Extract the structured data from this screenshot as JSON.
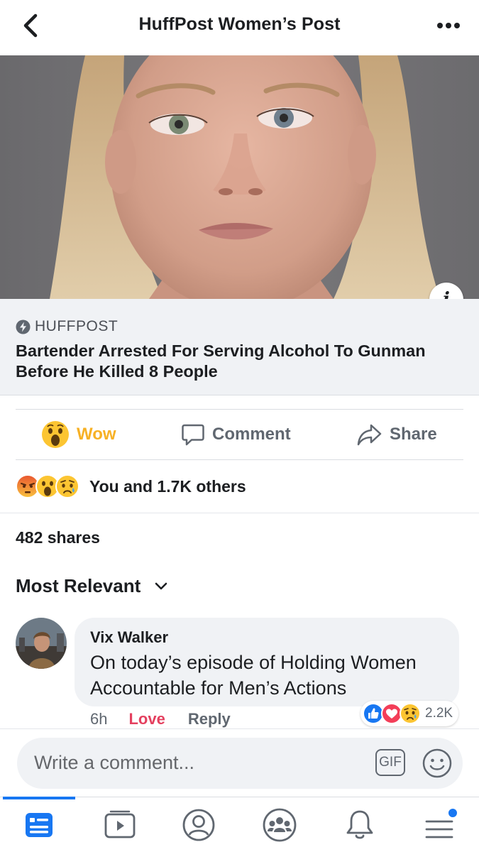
{
  "header": {
    "title": "HuffPost Women’s Post"
  },
  "link_card": {
    "source": "HUFFPOST",
    "headline": "Bartender Arrested For Serving Alcohol To Gunman Before He Killed 8 People",
    "info_glyph": "i"
  },
  "actions": {
    "wow_label": "Wow",
    "comment_label": "Comment",
    "share_label": "Share"
  },
  "reactions": {
    "icons": [
      "angry-icon",
      "wow-icon",
      "sad-icon"
    ],
    "summary": "You and 1.7K others"
  },
  "shares": {
    "text": "482 shares"
  },
  "comments": {
    "sort_label": "Most Relevant",
    "items": [
      {
        "author": "Vix Walker",
        "text": "On today’s episode of Holding Women Accountable for Men’s Actions",
        "time": "6h",
        "love_label": "Love",
        "reply_label": "Reply",
        "reaction_icons": [
          "like-icon",
          "love-icon",
          "sad-icon"
        ],
        "reaction_count": "2.2K"
      }
    ]
  },
  "composer": {
    "placeholder": "Write a comment...",
    "gif_label": "GIF"
  },
  "tabbar": {
    "tabs": [
      "news-feed-icon",
      "watch-icon",
      "profile-icon",
      "groups-icon",
      "notifications-icon",
      "menu-icon"
    ],
    "active": "news-feed-icon"
  },
  "colors": {
    "brand_blue": "#1877f2",
    "wow_yellow": "#f7b125",
    "love_red": "#e4405f",
    "secondary_text": "#606770"
  }
}
